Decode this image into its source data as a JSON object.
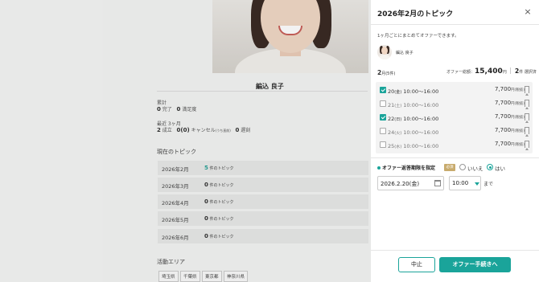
{
  "background": {
    "profile_name": "編込 良子",
    "stats": {
      "total_label": "累計",
      "total_done_value": "0",
      "total_done_label": "完了",
      "total_satisfaction_value": "0",
      "total_satisfaction_label": "満足度",
      "recent_label": "最近 3ヶ月",
      "recent_done_value": "2",
      "recent_done_label": "成立",
      "recent_cancel_value": "0",
      "recent_cancel_paren": "(0)",
      "recent_cancel_label": "キャンセル",
      "recent_cancel_note": "(うち直前)",
      "recent_late_value": "0",
      "recent_late_label": "遅刻"
    },
    "current_topic_heading": "現在のトピック",
    "topic_rows": [
      {
        "month": "2026年2月",
        "count": "5",
        "suffix": "件のトピック"
      },
      {
        "month": "2026年3月",
        "count": "0",
        "suffix": "件のトピック"
      },
      {
        "month": "2026年4月",
        "count": "0",
        "suffix": "件のトピック"
      },
      {
        "month": "2026年5月",
        "count": "0",
        "suffix": "件のトピック"
      },
      {
        "month": "2026年6月",
        "count": "0",
        "suffix": "件のトピック"
      }
    ],
    "area_heading": "活動エリア",
    "areas": [
      "埼玉県",
      "千葉県",
      "東京都",
      "神奈川県"
    ]
  },
  "panel": {
    "title": "2026年2月のトピック",
    "close_symbol": "×",
    "description": "1ヶ月ごとにまとめてオファーできます。",
    "agent_name": "編込 良子",
    "month_num": "2",
    "month_suffix": "月(5件)",
    "total_label": "オファー総額：",
    "total_value": "15,400",
    "total_unit": "円",
    "selected_count": "2",
    "selected_suffix": "件 選択済",
    "dates": [
      {
        "day": "20",
        "dow": "(金)",
        "time": "10:00〜16:00",
        "price": "7,700",
        "price_unit": "円(税抜)",
        "checked": true
      },
      {
        "day": "21",
        "dow": "(土)",
        "time": "10:00〜16:00",
        "price": "7,700",
        "price_unit": "円(税抜)",
        "checked": false
      },
      {
        "day": "22",
        "dow": "(日)",
        "time": "10:00〜16:00",
        "price": "7,700",
        "price_unit": "円(税抜)",
        "checked": true
      },
      {
        "day": "24",
        "dow": "(火)",
        "time": "10:00〜16:00",
        "price": "7,700",
        "price_unit": "円(税抜)",
        "checked": false
      },
      {
        "day": "25",
        "dow": "(水)",
        "time": "10:00〜16:00",
        "price": "7,700",
        "price_unit": "円(税抜)",
        "checked": false
      }
    ],
    "deadline_label": "オファー返答期限を指定",
    "required_badge": "必須",
    "option_no": "いいえ",
    "option_yes": "はい",
    "selected_option": "はい",
    "deadline_date": "2026.2.20(金)",
    "deadline_time": "10:00",
    "until_label": "まで",
    "cancel_label": "中止",
    "submit_label": "オファー手続きへ"
  },
  "colors": {
    "accent": "#1aa49a",
    "badge": "#c8ab6d"
  }
}
